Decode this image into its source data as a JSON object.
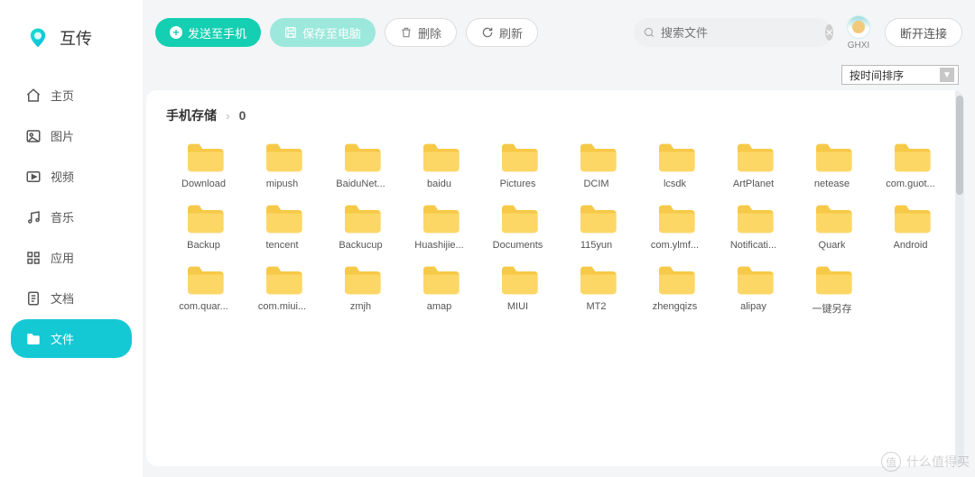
{
  "brand": {
    "name": "互传"
  },
  "sidebar": {
    "items": [
      {
        "label": "主页",
        "icon": "home-icon"
      },
      {
        "label": "图片",
        "icon": "image-icon"
      },
      {
        "label": "视频",
        "icon": "video-icon"
      },
      {
        "label": "音乐",
        "icon": "music-icon"
      },
      {
        "label": "应用",
        "icon": "apps-icon"
      },
      {
        "label": "文档",
        "icon": "doc-icon"
      },
      {
        "label": "文件",
        "icon": "folder-icon"
      }
    ],
    "active_index": 6
  },
  "toolbar": {
    "send_label": "发送至手机",
    "save_label": "保存至电脑",
    "delete_label": "删除",
    "refresh_label": "刷新",
    "disconnect_label": "断开连接"
  },
  "search": {
    "placeholder": "搜索文件"
  },
  "user": {
    "name": "GHXI"
  },
  "sort": {
    "selected": "按时间排序"
  },
  "breadcrumb": {
    "root": "手机存储",
    "count": "0"
  },
  "folders": [
    "Download",
    "mipush",
    "BaiduNet...",
    "baidu",
    "Pictures",
    "DCIM",
    "lcsdk",
    "ArtPlanet",
    "netease",
    "com.guot...",
    "Backup",
    "tencent",
    "Backucup",
    "Huashijie...",
    "Documents",
    "115yun",
    "com.ylmf...",
    "Notificati...",
    "Quark",
    "Android",
    "com.quar...",
    "com.miui...",
    "zmjh",
    "amap",
    "MIUI",
    "MT2",
    "zhengqizs",
    "alipay",
    "一键另存"
  ],
  "watermark": {
    "badge": "值",
    "text": "什么值得买"
  }
}
